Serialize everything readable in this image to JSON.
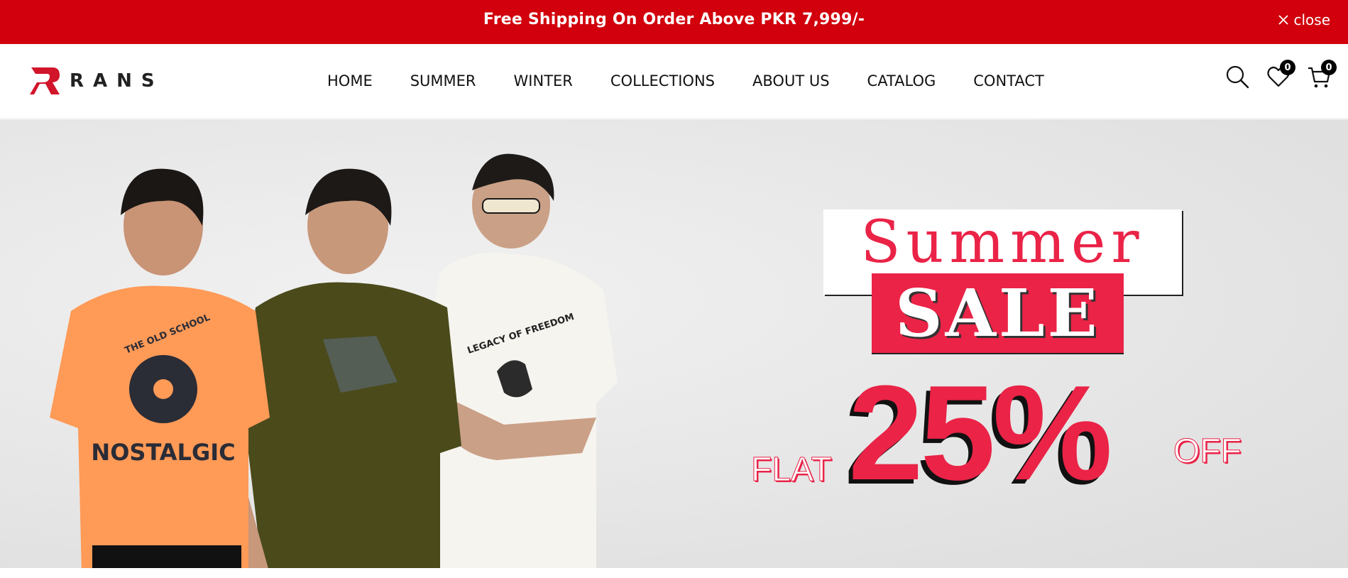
{
  "announcement": {
    "message": "Free Shipping On Order Above PKR 7,999/-",
    "close_label": "close",
    "background": "#d1000c"
  },
  "header": {
    "brand": "RANS",
    "nav": [
      {
        "label": "HOME"
      },
      {
        "label": "SUMMER"
      },
      {
        "label": "WINTER"
      },
      {
        "label": "COLLECTIONS"
      },
      {
        "label": "ABOUT US"
      },
      {
        "label": "CATALOG"
      },
      {
        "label": "CONTACT"
      }
    ],
    "icons": {
      "search": "search-icon",
      "wishlist": "heart-icon",
      "wishlist_count": "0",
      "cart": "cart-icon",
      "cart_count": "0"
    }
  },
  "hero": {
    "promo": {
      "line1": "Summer",
      "line2": "SALE",
      "prefix": "FLAT",
      "discount": "25%",
      "suffix": "OFF",
      "accent": "#ea2347"
    },
    "tshirts": [
      {
        "color": "#ff9a57",
        "print_text_top": "THE OLD SCHOOL",
        "print_text_main": "NOSTALGIC"
      },
      {
        "color": "#4a4a1b"
      },
      {
        "color": "#f6f4ef",
        "print_text_top": "LEGACY OF FREEDOM"
      }
    ]
  }
}
